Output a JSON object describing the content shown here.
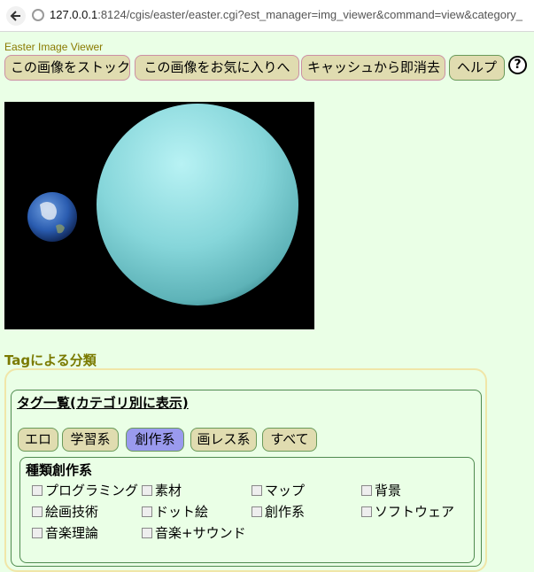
{
  "browser": {
    "url_host": "127.0.0.1",
    "url_rest": ":8124/cgis/easter/easter.cgi?est_manager=img_viewer&command=view&category_"
  },
  "app": {
    "title": "Easter Image Viewer"
  },
  "toolbar": {
    "stock_label": "この画像をストック",
    "favorite_label": "この画像をお気に入りへ",
    "cache_delete_label": "キャッシュから即消去",
    "help_label": "ヘルプ",
    "help_icon": "?"
  },
  "tags": {
    "section_title": "Tagによる分類",
    "panel_title": "タグ一覧(カテゴリ別に表示)",
    "categories": [
      {
        "label": "エロ",
        "active": false
      },
      {
        "label": "学習系",
        "active": false
      },
      {
        "label": "創作系",
        "active": true
      },
      {
        "label": "画レス系",
        "active": false
      },
      {
        "label": "すべて",
        "active": false
      }
    ],
    "type_title": "種類創作系",
    "items": [
      "プログラミング",
      "素材",
      "マップ",
      "背景",
      "絵画技術",
      "ドット絵",
      "創作系",
      "ソフトウェア",
      "音楽理論",
      "音楽+サウンド"
    ]
  }
}
